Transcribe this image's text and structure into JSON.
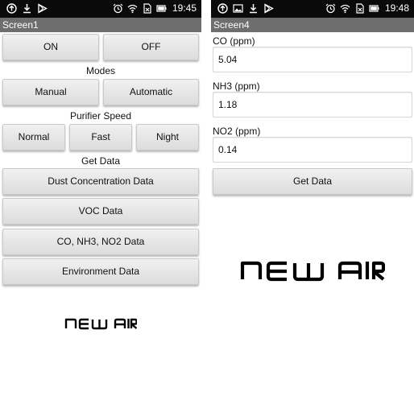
{
  "screen1": {
    "status_time": "19:45",
    "title": "Screen1",
    "power": {
      "on_label": "ON",
      "off_label": "OFF"
    },
    "modes": {
      "heading": "Modes",
      "manual_label": "Manual",
      "automatic_label": "Automatic"
    },
    "speed": {
      "heading": "Purifier Speed",
      "normal_label": "Normal",
      "fast_label": "Fast",
      "night_label": "Night"
    },
    "get_data": {
      "heading": "Get Data",
      "dust_label": "Dust Concentration Data",
      "voc_label": "VOC Data",
      "gases_label": "CO, NH3, NO2 Data",
      "environment_label": "Environment Data"
    },
    "logo_text": "NEW AIR"
  },
  "screen4": {
    "status_time": "19:48",
    "title": "Screen4",
    "co": {
      "label": "CO (ppm)",
      "value": "5.04"
    },
    "nh3": {
      "label": "NH3 (ppm)",
      "value": "1.18"
    },
    "no2": {
      "label": "NO2 (ppm)",
      "value": "0.14"
    },
    "get_data_label": "Get Data",
    "logo_text": "NEW AIR"
  },
  "icons": {
    "screen1_left": [
      "upload-icon",
      "download-icon",
      "play-store-icon"
    ],
    "screen4_left": [
      "upload-icon",
      "image-icon",
      "download-icon",
      "play-store-icon"
    ],
    "status_right": [
      "alarm-icon",
      "wifi-icon",
      "no-sim-icon",
      "battery-icon"
    ]
  },
  "colors": {
    "status_bar": "#0a0a0a",
    "title_bar": "#6e6e6e",
    "button_top": "#f1f1f1",
    "button_bottom": "#dcdcdc"
  }
}
